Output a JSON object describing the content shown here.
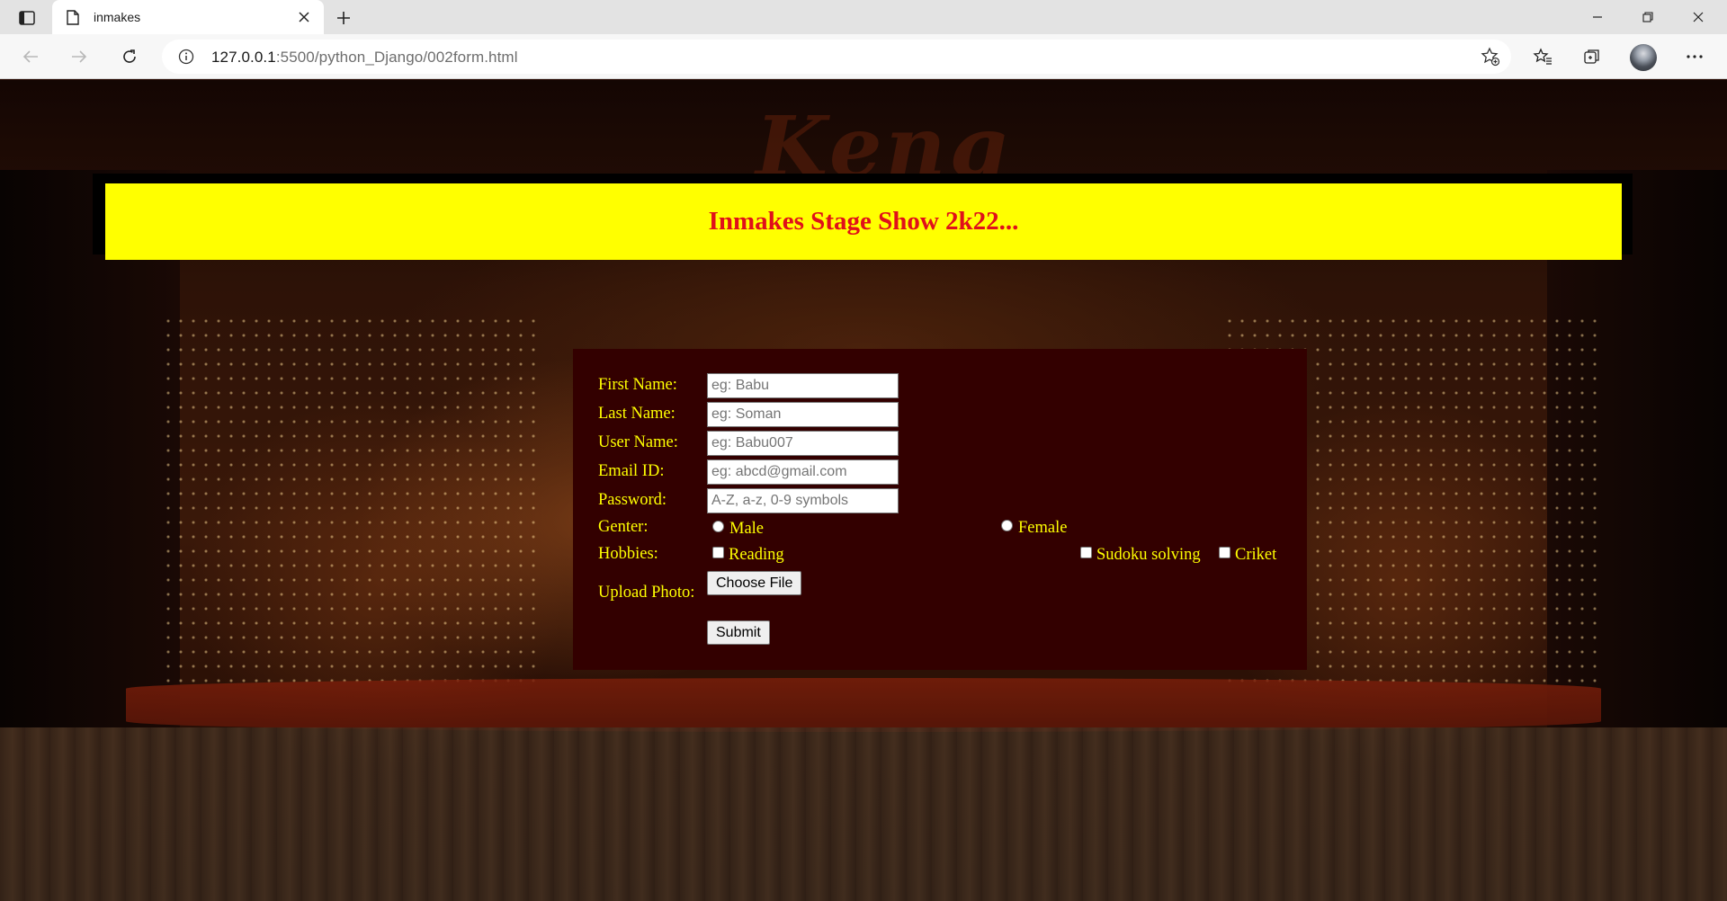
{
  "browser": {
    "tab_title": "inmakes",
    "url_host": "127.0.0.1",
    "url_path": ":5500/python_Django/002form.html"
  },
  "page": {
    "banner_title": "Inmakes Stage Show 2k22...",
    "background_logo_text": "Keng"
  },
  "form": {
    "first_name": {
      "label": "First Name:",
      "placeholder": "eg: Babu"
    },
    "last_name": {
      "label": "Last Name:",
      "placeholder": "eg: Soman"
    },
    "user_name": {
      "label": "User Name:",
      "placeholder": "eg: Babu007"
    },
    "email": {
      "label": "Email ID:",
      "placeholder": "eg: abcd@gmail.com"
    },
    "password": {
      "label": "Password:",
      "placeholder": "A-Z, a-z, 0-9 symbols"
    },
    "gender": {
      "label": "Genter:",
      "options": [
        "Male",
        "Female"
      ]
    },
    "hobbies": {
      "label": "Hobbies:",
      "options": [
        "Reading",
        "Sudoku solving",
        "Criket"
      ]
    },
    "upload": {
      "label": "Upload Photo:",
      "button": "Choose File"
    },
    "submit": "Submit"
  },
  "colors": {
    "banner_bg": "#ffff00",
    "banner_text": "#e0101a",
    "form_bg": "#330000",
    "label_text": "#ffff00"
  }
}
